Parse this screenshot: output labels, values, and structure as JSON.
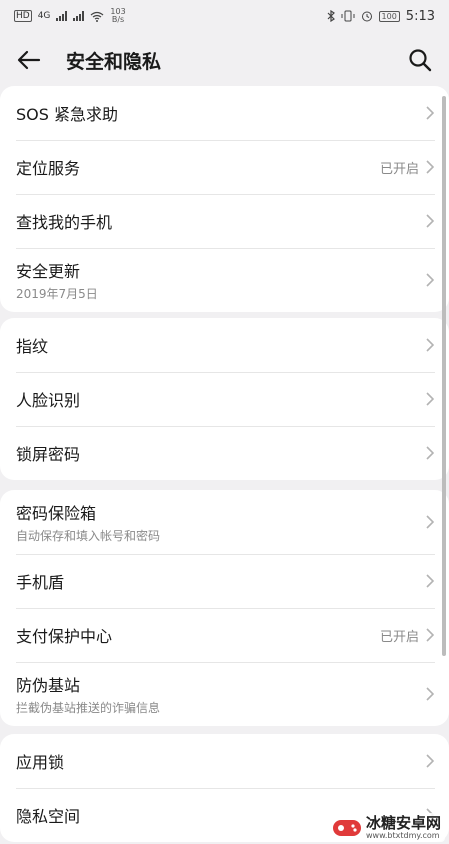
{
  "status_bar": {
    "network_label": "4G",
    "speed_value": "103",
    "speed_unit": "B/s",
    "battery_percent": "100",
    "time": "5:13"
  },
  "header": {
    "title": "安全和隐私",
    "back_icon": "arrow-left-icon",
    "search_icon": "search-icon"
  },
  "groups": [
    {
      "items": [
        {
          "label": "SOS 紧急求助"
        },
        {
          "label": "定位服务",
          "status": "已开启"
        },
        {
          "label": "查找我的手机"
        },
        {
          "label": "安全更新",
          "sub": "2019年7月5日"
        }
      ]
    },
    {
      "items": [
        {
          "label": "指纹"
        },
        {
          "label": "人脸识别"
        },
        {
          "label": "锁屏密码"
        }
      ]
    },
    {
      "items": [
        {
          "label": "密码保险箱",
          "sub": "自动保存和填入帐号和密码"
        },
        {
          "label": "手机盾"
        },
        {
          "label": "支付保护中心",
          "status": "已开启"
        },
        {
          "label": "防伪基站",
          "sub": "拦截伪基站推送的诈骗信息"
        }
      ]
    },
    {
      "items": [
        {
          "label": "应用锁"
        },
        {
          "label": "隐私空间"
        }
      ]
    }
  ],
  "watermark": {
    "title": "冰糖安卓网",
    "url": "www.btxtdmy.com"
  },
  "colors": {
    "background": "#f1f0f2",
    "card": "#ffffff",
    "secondary_text": "#8a8a8a"
  }
}
